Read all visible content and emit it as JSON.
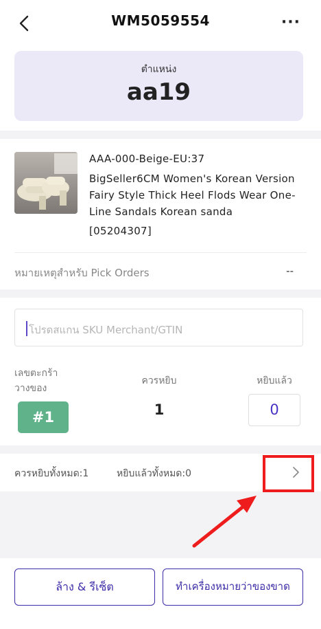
{
  "header": {
    "title": "WM5059554",
    "back_icon": "chevron-left-icon",
    "more_label": "···"
  },
  "location": {
    "label": "ตำแหน่ง",
    "value": "aa19"
  },
  "product": {
    "sku": "AAA-000-Beige-EU:37",
    "name": "BigSeller6CM  Women's Korean Version Fairy Style Thick Heel Flods Wear One-Line Sandals Korean sanda",
    "code": "[05204307]"
  },
  "pick_note": {
    "label": "หมายเหตุสำหรับ Pick Orders",
    "value": "--"
  },
  "scan": {
    "placeholder": "โปรดสแกน SKU Merchant/GTIN"
  },
  "pick": {
    "basket_label_line1": "เลขตะกร้า",
    "basket_label_line2": "วางของ",
    "basket_value": "#1",
    "needed_label": "ควรหยิบ",
    "needed_value": "1",
    "picked_label": "หยิบแล้ว",
    "picked_value": "0"
  },
  "summary": {
    "total_text": "ควรหยิบทั้งหมด:1",
    "picked_text": "หยิบแล้วทั้งหมด:0"
  },
  "footer": {
    "reset_label": "ล้าง & รีเซ็ต",
    "missing_label": "ทำเครื่องหมายว่าของขาด"
  },
  "colors": {
    "accent": "#3a2ba8",
    "location_bg": "#ebe8f7",
    "basket_green": "#5fb28a",
    "annotation_red": "#ee1c1c"
  }
}
